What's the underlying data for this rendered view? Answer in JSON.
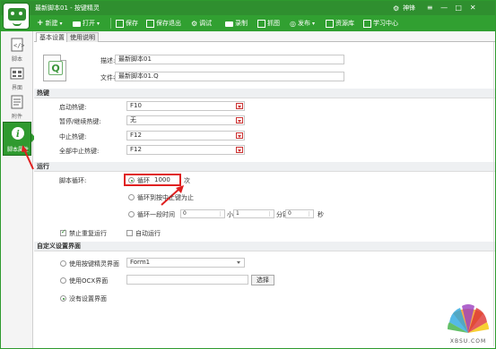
{
  "window": {
    "title": "最新脚本01 - 按键精灵",
    "user_label": "神锋"
  },
  "toolbar": {
    "new_label": "新建",
    "open_label": "打开",
    "save_label": "保存",
    "save_exit_label": "保存退出",
    "debug_label": "调试",
    "record_label": "录制",
    "capture_label": "抓图",
    "publish_label": "发布",
    "resources_label": "资源库",
    "learn_label": "学习中心"
  },
  "sidebar": {
    "items": [
      {
        "label": "脚本"
      },
      {
        "label": "界面"
      },
      {
        "label": "附件"
      },
      {
        "label": "脚本属性"
      }
    ]
  },
  "tabs": [
    {
      "label": "基本设置"
    },
    {
      "label": "使用说明"
    }
  ],
  "basic": {
    "desc_label": "描述:",
    "desc_value": "最新脚本01",
    "filename_label": "文件名:",
    "filename_value": "最新脚本01.Q"
  },
  "hotkeys": {
    "heading": "热键",
    "start_label": "启动热键:",
    "start_value": "F10",
    "pause_label": "暂停/继续热键:",
    "pause_value": "无",
    "stop_label": "中止热键:",
    "stop_value": "F12",
    "stop_all_label": "全部中止热键:",
    "stop_all_value": "F12"
  },
  "run": {
    "heading": "运行",
    "loop_label": "脚本循环:",
    "loop_option": "循环",
    "loop_count": "1000",
    "loop_unit": "次",
    "until_stop_label": "循环到按中止键为止",
    "timed_label": "循环一段时间",
    "hours_value": "0",
    "hours_unit": "小时",
    "minutes_value": "1",
    "minutes_unit": "分钟",
    "seconds_value": "0",
    "seconds_unit": "秒",
    "no_repeat_label": "禁止重复运行",
    "auto_run_label": "自动运行"
  },
  "custom_ui": {
    "heading": "自定义设置界面",
    "use_wizard_label": "使用按键精灵界面",
    "form_value": "Form1",
    "use_ocx_label": "使用OCX界面",
    "choose_label": "选择",
    "no_ui_label": "没有设置界面"
  },
  "watermark": {
    "text": "XBSU.COM"
  },
  "colors": {
    "brand_green": "#2f8f2f",
    "annotation_red": "#e02020"
  }
}
